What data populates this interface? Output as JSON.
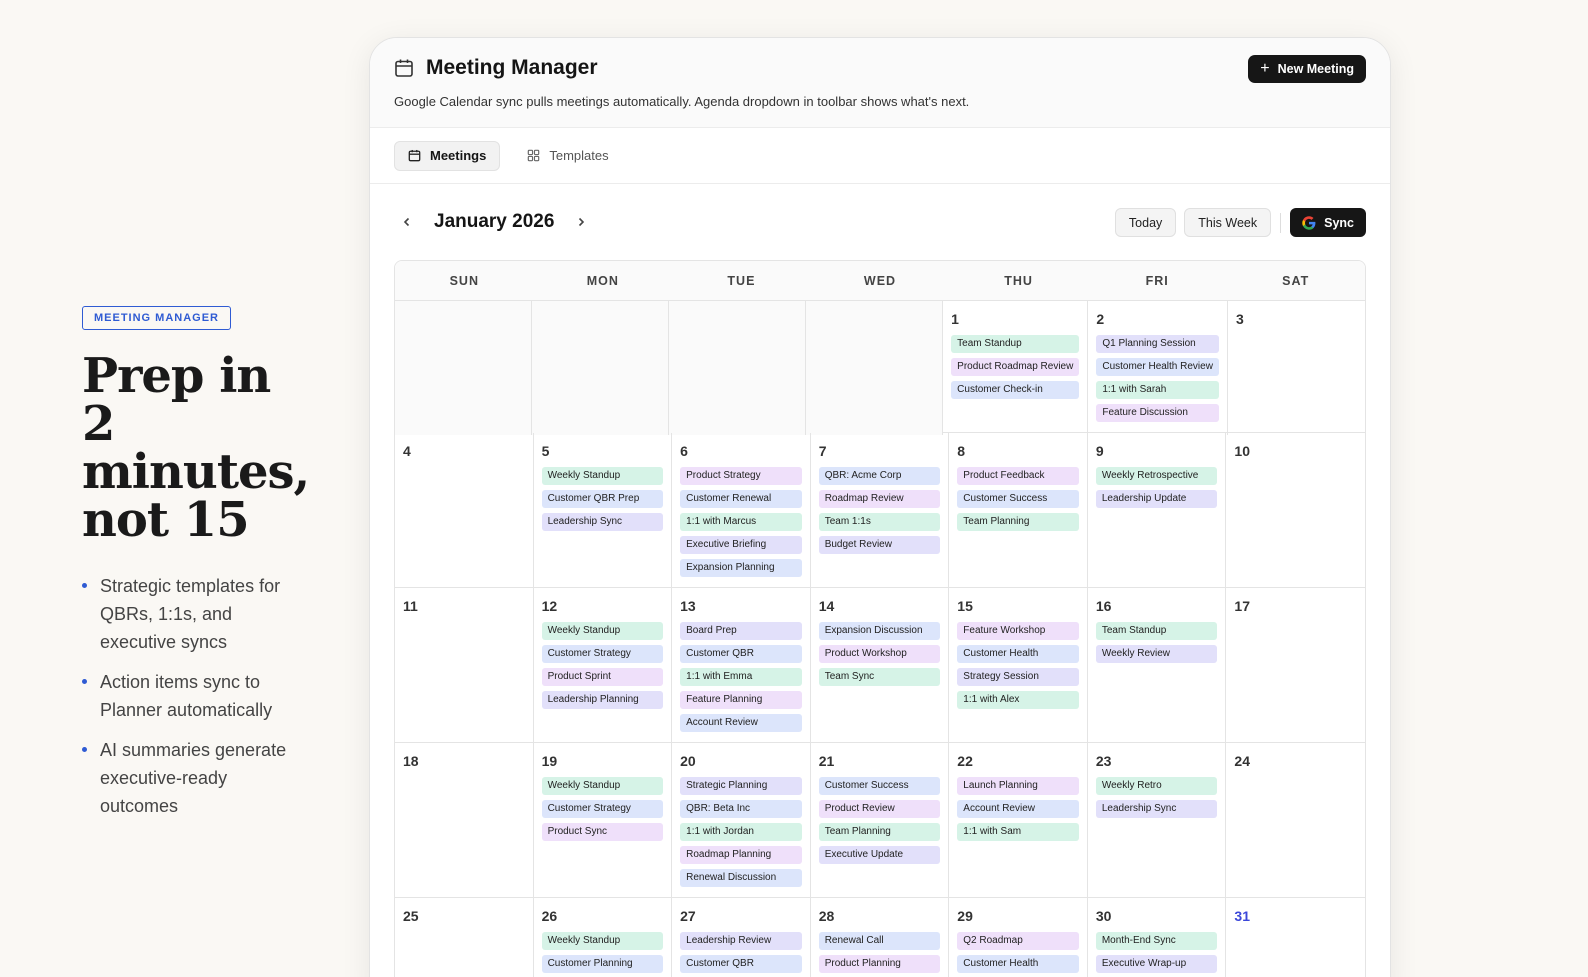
{
  "marketing": {
    "badge": "MEETING MANAGER",
    "headline_lines": [
      "Prep in",
      "2",
      "minutes,",
      "not 15"
    ],
    "bullets": [
      "Strategic templates for QBRs, 1:1s, and executive syncs",
      "Action items sync to Planner automatically",
      "AI summaries generate executive-ready outcomes"
    ]
  },
  "app": {
    "title": "Meeting Manager",
    "subtitle": "Google Calendar sync pulls meetings automatically. Agenda dropdown in toolbar shows what's next.",
    "new_meeting_label": "New Meeting",
    "tabs": [
      {
        "label": "Meetings",
        "icon": "calendar-icon",
        "active": true
      },
      {
        "label": "Templates",
        "icon": "grid-icon",
        "active": false
      }
    ],
    "month_label": "January 2026",
    "today_label": "Today",
    "this_week_label": "This Week",
    "sync_label": "Sync",
    "days_of_week": [
      "SUN",
      "MON",
      "TUE",
      "WED",
      "THU",
      "FRI",
      "SAT"
    ],
    "colors": {
      "green": "#d6f3e7",
      "blue": "#dce5fb",
      "purple": "#efe0fa",
      "lavender": "#e2e0fa",
      "today": "#3b47d9"
    },
    "weeks": [
      [
        {
          "day": "",
          "events": []
        },
        {
          "day": "",
          "events": []
        },
        {
          "day": "",
          "events": []
        },
        {
          "day": "",
          "events": []
        },
        {
          "day": "1",
          "events": [
            {
              "title": "Team Standup",
              "color": "green"
            },
            {
              "title": "Product Roadmap Review",
              "color": "purple"
            },
            {
              "title": "Customer Check-in",
              "color": "blue"
            }
          ]
        },
        {
          "day": "2",
          "events": [
            {
              "title": "Q1 Planning Session",
              "color": "lavender"
            },
            {
              "title": "Customer Health Review",
              "color": "blue"
            },
            {
              "title": "1:1 with Sarah",
              "color": "green"
            },
            {
              "title": "Feature Discussion",
              "color": "purple"
            }
          ]
        },
        {
          "day": "3",
          "events": []
        }
      ],
      [
        {
          "day": "4",
          "events": []
        },
        {
          "day": "5",
          "events": [
            {
              "title": "Weekly Standup",
              "color": "green"
            },
            {
              "title": "Customer QBR Prep",
              "color": "blue"
            },
            {
              "title": "Leadership Sync",
              "color": "lavender"
            }
          ]
        },
        {
          "day": "6",
          "events": [
            {
              "title": "Product Strategy",
              "color": "purple"
            },
            {
              "title": "Customer Renewal",
              "color": "blue"
            },
            {
              "title": "1:1 with Marcus",
              "color": "green"
            },
            {
              "title": "Executive Briefing",
              "color": "lavender"
            },
            {
              "title": "Expansion Planning",
              "color": "blue"
            }
          ]
        },
        {
          "day": "7",
          "events": [
            {
              "title": "QBR: Acme Corp",
              "color": "blue"
            },
            {
              "title": "Roadmap Review",
              "color": "purple"
            },
            {
              "title": "Team 1:1s",
              "color": "green"
            },
            {
              "title": "Budget Review",
              "color": "lavender"
            }
          ]
        },
        {
          "day": "8",
          "events": [
            {
              "title": "Product Feedback",
              "color": "purple"
            },
            {
              "title": "Customer Success",
              "color": "blue"
            },
            {
              "title": "Team Planning",
              "color": "green"
            }
          ]
        },
        {
          "day": "9",
          "events": [
            {
              "title": "Weekly Retrospective",
              "color": "green"
            },
            {
              "title": "Leadership Update",
              "color": "lavender"
            }
          ]
        },
        {
          "day": "10",
          "events": []
        }
      ],
      [
        {
          "day": "11",
          "events": []
        },
        {
          "day": "12",
          "events": [
            {
              "title": "Weekly Standup",
              "color": "green"
            },
            {
              "title": "Customer Strategy",
              "color": "blue"
            },
            {
              "title": "Product Sprint",
              "color": "purple"
            },
            {
              "title": "Leadership Planning",
              "color": "lavender"
            }
          ]
        },
        {
          "day": "13",
          "events": [
            {
              "title": "Board Prep",
              "color": "lavender"
            },
            {
              "title": "Customer QBR",
              "color": "blue"
            },
            {
              "title": "1:1 with Emma",
              "color": "green"
            },
            {
              "title": "Feature Planning",
              "color": "purple"
            },
            {
              "title": "Account Review",
              "color": "blue"
            }
          ]
        },
        {
          "day": "14",
          "events": [
            {
              "title": "Expansion Discussion",
              "color": "blue"
            },
            {
              "title": "Product Workshop",
              "color": "purple"
            },
            {
              "title": "Team Sync",
              "color": "green"
            }
          ]
        },
        {
          "day": "15",
          "events": [
            {
              "title": "Feature Workshop",
              "color": "purple"
            },
            {
              "title": "Customer Health",
              "color": "blue"
            },
            {
              "title": "Strategy Session",
              "color": "lavender"
            },
            {
              "title": "1:1 with Alex",
              "color": "green"
            }
          ]
        },
        {
          "day": "16",
          "events": [
            {
              "title": "Team Standup",
              "color": "green"
            },
            {
              "title": "Weekly Review",
              "color": "lavender"
            }
          ]
        },
        {
          "day": "17",
          "events": []
        }
      ],
      [
        {
          "day": "18",
          "events": []
        },
        {
          "day": "19",
          "events": [
            {
              "title": "Weekly Standup",
              "color": "green"
            },
            {
              "title": "Customer Strategy",
              "color": "blue"
            },
            {
              "title": "Product Sync",
              "color": "purple"
            }
          ]
        },
        {
          "day": "20",
          "events": [
            {
              "title": "Strategic Planning",
              "color": "lavender"
            },
            {
              "title": "QBR: Beta Inc",
              "color": "blue"
            },
            {
              "title": "1:1 with Jordan",
              "color": "green"
            },
            {
              "title": "Roadmap Planning",
              "color": "purple"
            },
            {
              "title": "Renewal Discussion",
              "color": "blue"
            }
          ]
        },
        {
          "day": "21",
          "events": [
            {
              "title": "Customer Success",
              "color": "blue"
            },
            {
              "title": "Product Review",
              "color": "purple"
            },
            {
              "title": "Team Planning",
              "color": "green"
            },
            {
              "title": "Executive Update",
              "color": "lavender"
            }
          ]
        },
        {
          "day": "22",
          "events": [
            {
              "title": "Launch Planning",
              "color": "purple"
            },
            {
              "title": "Account Review",
              "color": "blue"
            },
            {
              "title": "1:1 with Sam",
              "color": "green"
            }
          ]
        },
        {
          "day": "23",
          "events": [
            {
              "title": "Weekly Retro",
              "color": "green"
            },
            {
              "title": "Leadership Sync",
              "color": "lavender"
            }
          ]
        },
        {
          "day": "24",
          "events": []
        }
      ],
      [
        {
          "day": "25",
          "events": []
        },
        {
          "day": "26",
          "events": [
            {
              "title": "Weekly Standup",
              "color": "green"
            },
            {
              "title": "Customer Planning",
              "color": "blue"
            }
          ]
        },
        {
          "day": "27",
          "events": [
            {
              "title": "Leadership Review",
              "color": "lavender"
            },
            {
              "title": "Customer QBR",
              "color": "blue"
            }
          ]
        },
        {
          "day": "28",
          "events": [
            {
              "title": "Renewal Call",
              "color": "blue"
            },
            {
              "title": "Product Planning",
              "color": "purple"
            }
          ]
        },
        {
          "day": "29",
          "events": [
            {
              "title": "Q2 Roadmap",
              "color": "purple"
            },
            {
              "title": "Customer Health",
              "color": "blue"
            }
          ]
        },
        {
          "day": "30",
          "events": [
            {
              "title": "Month-End Sync",
              "color": "green"
            },
            {
              "title": "Executive Wrap-up",
              "color": "lavender"
            }
          ]
        },
        {
          "day": "31",
          "today": true,
          "events": []
        }
      ]
    ]
  }
}
